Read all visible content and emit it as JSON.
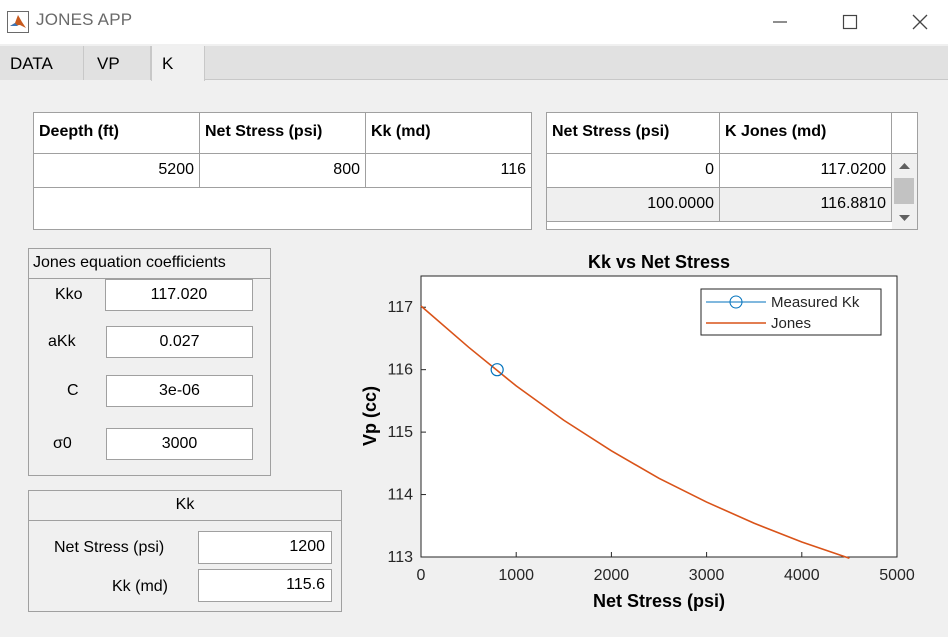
{
  "window": {
    "title": "JONES APP",
    "controls": {
      "minimize": "—",
      "maximize": "☐",
      "close": "✕"
    }
  },
  "tabs": [
    {
      "label": "DATA"
    },
    {
      "label": "VP"
    },
    {
      "label": "K",
      "active": true
    }
  ],
  "data_table": {
    "headers": [
      "Deepth (ft)",
      "Net Stress (psi)",
      "Kk (md)"
    ],
    "rows": [
      [
        "5200",
        "800",
        "116"
      ]
    ]
  },
  "jones_table": {
    "headers": [
      "Net Stress (psi)",
      "K Jones (md)"
    ],
    "rows": [
      [
        "0",
        "117.0200"
      ],
      [
        "100.0000",
        "116.8810"
      ]
    ]
  },
  "coefficients": {
    "title": "Jones equation coefficients",
    "kko_label": "Kko",
    "kko_value": "117.020",
    "akk_label": "aKk",
    "akk_value": "0.027",
    "c_label": "C",
    "c_value": "3e-06",
    "sigma_label": "σ0",
    "sigma_value": "3000"
  },
  "kk_panel": {
    "title": "Kk",
    "net_stress_label": "Net Stress (psi)",
    "net_stress_value": "1200",
    "kk_label": "Kk (md)",
    "kk_value": "115.6"
  },
  "colors": {
    "measured": "#0072bd",
    "jones": "#d95319"
  },
  "chart_data": {
    "type": "line",
    "title": "Kk vs Net Stress",
    "xlabel": "Net Stress (psi)",
    "ylabel": "Vp (cc)",
    "xlim": [
      0,
      5000
    ],
    "ylim": [
      113,
      117.5
    ],
    "xticks": [
      0,
      1000,
      2000,
      3000,
      4000,
      5000
    ],
    "yticks": [
      113,
      114,
      115,
      116,
      117
    ],
    "legend_position": "top-right",
    "series": [
      {
        "name": "Measured Kk",
        "marker": "circle",
        "x": [
          800
        ],
        "y": [
          116
        ]
      },
      {
        "name": "Jones",
        "marker": "none",
        "x": [
          0,
          500,
          1000,
          1500,
          2000,
          2500,
          3000,
          3500,
          4000,
          4500
        ],
        "y": [
          117.02,
          116.36,
          115.74,
          115.19,
          114.7,
          114.26,
          113.88,
          113.54,
          113.24,
          112.98
        ]
      }
    ]
  }
}
